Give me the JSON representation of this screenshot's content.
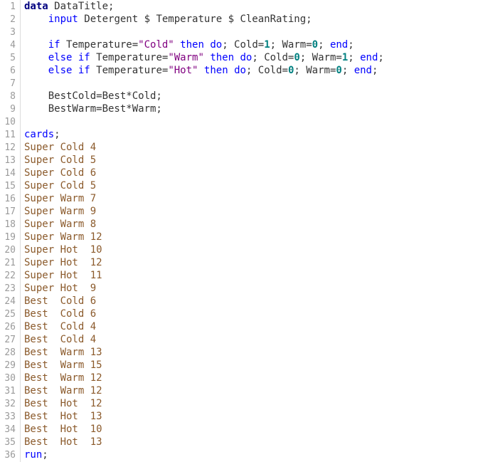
{
  "editor": {
    "colors": {
      "keyword": "#0000ff",
      "statement": "#000080",
      "string": "#800080",
      "number": "#008080",
      "datalines": "#8b5a2b",
      "plain": "#333333",
      "line_number": "#9a9a9a"
    },
    "lines": [
      {
        "n": "1",
        "tokens": [
          {
            "t": "data",
            "c": "kwb"
          },
          {
            "t": " DataTitle;",
            "c": "plain"
          }
        ]
      },
      {
        "n": "2",
        "tokens": [
          {
            "t": "    ",
            "c": "plain"
          },
          {
            "t": "input",
            "c": "kw"
          },
          {
            "t": " Detergent $ Temperature $ CleanRating;",
            "c": "plain"
          }
        ]
      },
      {
        "n": "3",
        "tokens": []
      },
      {
        "n": "4",
        "tokens": [
          {
            "t": "    ",
            "c": "plain"
          },
          {
            "t": "if",
            "c": "kw"
          },
          {
            "t": " Temperature=",
            "c": "plain"
          },
          {
            "t": "\"Cold\"",
            "c": "str"
          },
          {
            "t": " ",
            "c": "plain"
          },
          {
            "t": "then",
            "c": "kw"
          },
          {
            "t": " ",
            "c": "plain"
          },
          {
            "t": "do",
            "c": "kw"
          },
          {
            "t": "; Cold=",
            "c": "plain"
          },
          {
            "t": "1",
            "c": "num"
          },
          {
            "t": "; Warm=",
            "c": "plain"
          },
          {
            "t": "0",
            "c": "num"
          },
          {
            "t": "; ",
            "c": "plain"
          },
          {
            "t": "end",
            "c": "kw"
          },
          {
            "t": ";",
            "c": "plain"
          }
        ]
      },
      {
        "n": "5",
        "tokens": [
          {
            "t": "    ",
            "c": "plain"
          },
          {
            "t": "else if",
            "c": "kw"
          },
          {
            "t": " Temperature=",
            "c": "plain"
          },
          {
            "t": "\"Warm\"",
            "c": "str"
          },
          {
            "t": " ",
            "c": "plain"
          },
          {
            "t": "then",
            "c": "kw"
          },
          {
            "t": " ",
            "c": "plain"
          },
          {
            "t": "do",
            "c": "kw"
          },
          {
            "t": "; Cold=",
            "c": "plain"
          },
          {
            "t": "0",
            "c": "num"
          },
          {
            "t": "; Warm=",
            "c": "plain"
          },
          {
            "t": "1",
            "c": "num"
          },
          {
            "t": "; ",
            "c": "plain"
          },
          {
            "t": "end",
            "c": "kw"
          },
          {
            "t": ";",
            "c": "plain"
          }
        ]
      },
      {
        "n": "6",
        "tokens": [
          {
            "t": "    ",
            "c": "plain"
          },
          {
            "t": "else if",
            "c": "kw"
          },
          {
            "t": " Temperature=",
            "c": "plain"
          },
          {
            "t": "\"Hot\"",
            "c": "str"
          },
          {
            "t": " ",
            "c": "plain"
          },
          {
            "t": "then",
            "c": "kw"
          },
          {
            "t": " ",
            "c": "plain"
          },
          {
            "t": "do",
            "c": "kw"
          },
          {
            "t": "; Cold=",
            "c": "plain"
          },
          {
            "t": "0",
            "c": "num"
          },
          {
            "t": "; Warm=",
            "c": "plain"
          },
          {
            "t": "0",
            "c": "num"
          },
          {
            "t": "; ",
            "c": "plain"
          },
          {
            "t": "end",
            "c": "kw"
          },
          {
            "t": ";",
            "c": "plain"
          }
        ]
      },
      {
        "n": "7",
        "tokens": []
      },
      {
        "n": "8",
        "tokens": [
          {
            "t": "    BestCold=Best*Cold;",
            "c": "plain"
          }
        ]
      },
      {
        "n": "9",
        "tokens": [
          {
            "t": "    BestWarm=Best*Warm;",
            "c": "plain"
          }
        ]
      },
      {
        "n": "10",
        "tokens": []
      },
      {
        "n": "11",
        "tokens": [
          {
            "t": "cards",
            "c": "kw"
          },
          {
            "t": ";",
            "c": "plain"
          }
        ]
      },
      {
        "n": "12",
        "tokens": [
          {
            "t": "Super Cold 4",
            "c": "data"
          }
        ]
      },
      {
        "n": "13",
        "tokens": [
          {
            "t": "Super Cold 5",
            "c": "data"
          }
        ]
      },
      {
        "n": "14",
        "tokens": [
          {
            "t": "Super Cold 6",
            "c": "data"
          }
        ]
      },
      {
        "n": "15",
        "tokens": [
          {
            "t": "Super Cold 5",
            "c": "data"
          }
        ]
      },
      {
        "n": "16",
        "tokens": [
          {
            "t": "Super Warm 7",
            "c": "data"
          }
        ]
      },
      {
        "n": "17",
        "tokens": [
          {
            "t": "Super Warm 9",
            "c": "data"
          }
        ]
      },
      {
        "n": "18",
        "tokens": [
          {
            "t": "Super Warm 8",
            "c": "data"
          }
        ]
      },
      {
        "n": "19",
        "tokens": [
          {
            "t": "Super Warm 12",
            "c": "data"
          }
        ]
      },
      {
        "n": "20",
        "tokens": [
          {
            "t": "Super Hot  10",
            "c": "data"
          }
        ]
      },
      {
        "n": "21",
        "tokens": [
          {
            "t": "Super Hot  12",
            "c": "data"
          }
        ]
      },
      {
        "n": "22",
        "tokens": [
          {
            "t": "Super Hot  11",
            "c": "data"
          }
        ]
      },
      {
        "n": "23",
        "tokens": [
          {
            "t": "Super Hot  9",
            "c": "data"
          }
        ]
      },
      {
        "n": "24",
        "tokens": [
          {
            "t": "Best  Cold 6",
            "c": "data"
          }
        ]
      },
      {
        "n": "25",
        "tokens": [
          {
            "t": "Best  Cold 6",
            "c": "data"
          }
        ]
      },
      {
        "n": "26",
        "tokens": [
          {
            "t": "Best  Cold 4",
            "c": "data"
          }
        ]
      },
      {
        "n": "27",
        "tokens": [
          {
            "t": "Best  Cold 4",
            "c": "data"
          }
        ]
      },
      {
        "n": "28",
        "tokens": [
          {
            "t": "Best  Warm 13",
            "c": "data"
          }
        ]
      },
      {
        "n": "29",
        "tokens": [
          {
            "t": "Best  Warm 15",
            "c": "data"
          }
        ]
      },
      {
        "n": "30",
        "tokens": [
          {
            "t": "Best  Warm 12",
            "c": "data"
          }
        ]
      },
      {
        "n": "31",
        "tokens": [
          {
            "t": "Best  Warm 12",
            "c": "data"
          }
        ]
      },
      {
        "n": "32",
        "tokens": [
          {
            "t": "Best  Hot  12",
            "c": "data"
          }
        ]
      },
      {
        "n": "33",
        "tokens": [
          {
            "t": "Best  Hot  13",
            "c": "data"
          }
        ]
      },
      {
        "n": "34",
        "tokens": [
          {
            "t": "Best  Hot  10",
            "c": "data"
          }
        ]
      },
      {
        "n": "35",
        "tokens": [
          {
            "t": "Best  Hot  13",
            "c": "data"
          }
        ]
      },
      {
        "n": "36",
        "tokens": [
          {
            "t": "run",
            "c": "kw"
          },
          {
            "t": ";",
            "c": "plain"
          }
        ]
      }
    ]
  }
}
